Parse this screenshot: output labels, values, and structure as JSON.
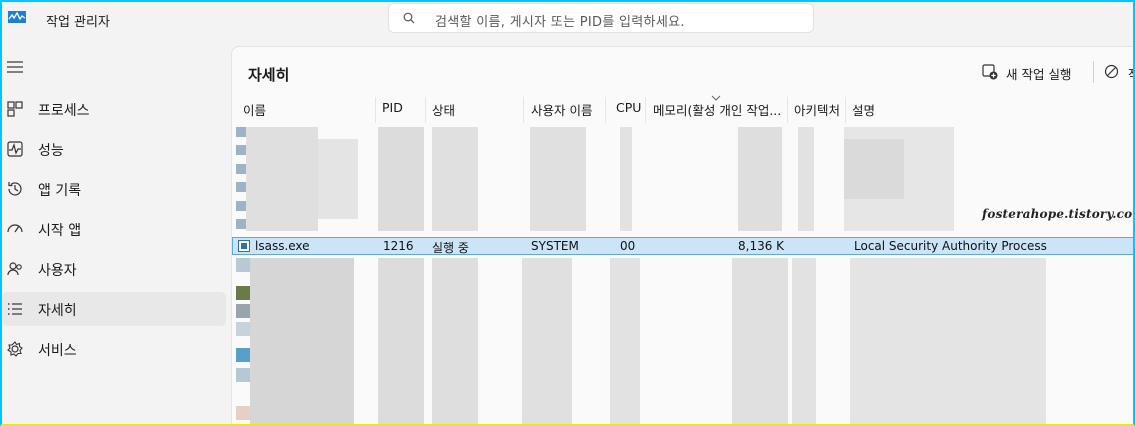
{
  "app": {
    "title": "작업 관리자"
  },
  "search": {
    "placeholder": "검색할 이름, 게시자 또는 PID를 입력하세요."
  },
  "sidebar": {
    "items": [
      {
        "label": "프로세스",
        "icon": "processes-icon"
      },
      {
        "label": "성능",
        "icon": "performance-icon"
      },
      {
        "label": "앱 기록",
        "icon": "app-history-icon"
      },
      {
        "label": "시작 앱",
        "icon": "startup-apps-icon"
      },
      {
        "label": "사용자",
        "icon": "users-icon"
      },
      {
        "label": "자세히",
        "icon": "details-icon",
        "active": true
      },
      {
        "label": "서비스",
        "icon": "services-icon"
      }
    ]
  },
  "main": {
    "title": "자세히",
    "run_task_label": "새 작업 실행",
    "end_task_label": "작",
    "columns": [
      "이름",
      "PID",
      "상태",
      "사용자 이름",
      "CPU",
      "메모리(활성 개인 작업...",
      "아키텍처",
      "설명"
    ],
    "selected_row": {
      "name": "lsass.exe",
      "pid": "1216",
      "status": "실행 중",
      "user": "SYSTEM",
      "cpu": "00",
      "memory": "8,136 K",
      "arch": "",
      "description": "Local Security Authority Process"
    }
  },
  "watermark": "fosterahope.tistory.com",
  "colors": {
    "accent": "#0067c0",
    "selection": "#cce4f7",
    "selection_border": "#5fa7df"
  }
}
